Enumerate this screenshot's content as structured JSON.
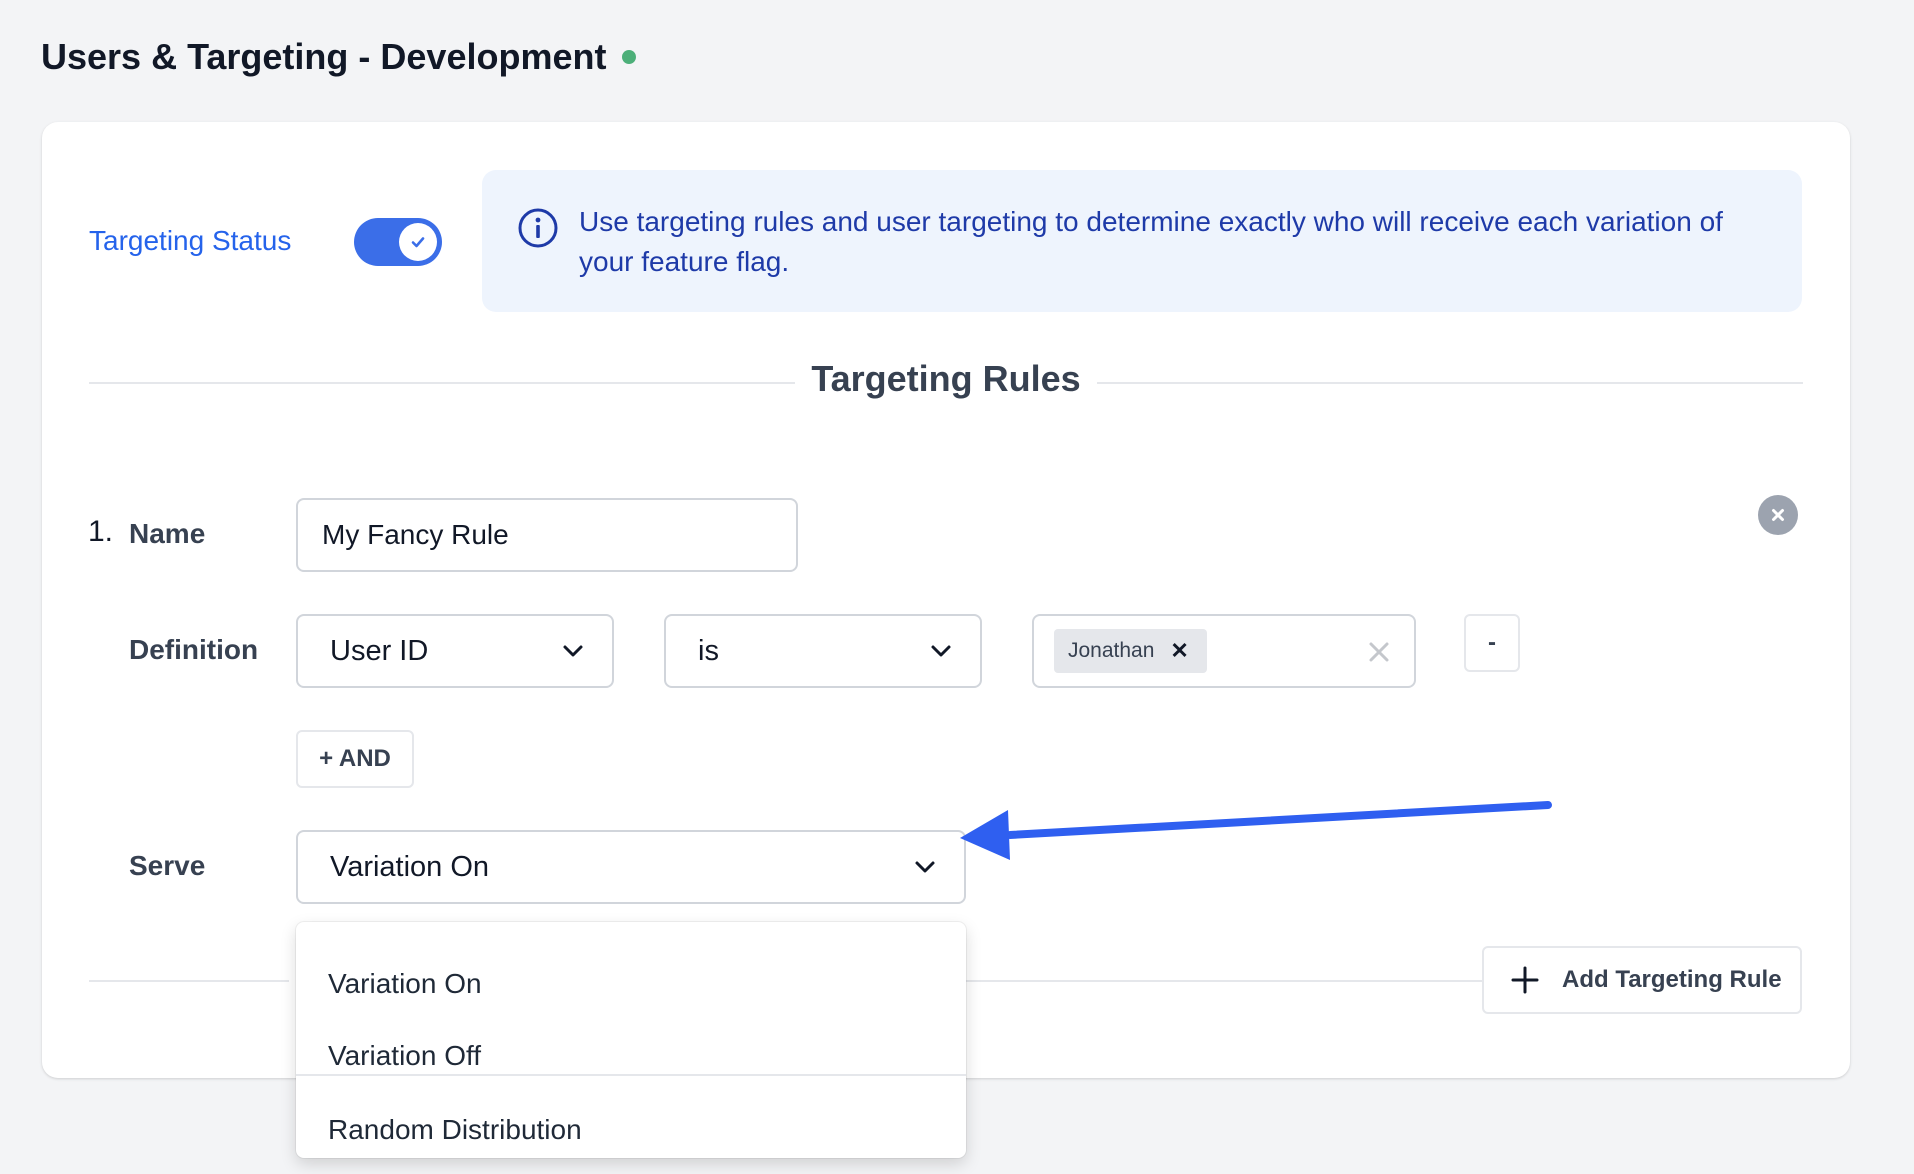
{
  "header": {
    "title": "Users & Targeting - Development",
    "status_color": "#4caf79"
  },
  "targeting": {
    "status_label": "Targeting Status",
    "status_on": true,
    "info_text": "Use targeting rules and user targeting to determine exactly who will receive each variation of your feature flag.",
    "section_title": "Targeting Rules"
  },
  "rule": {
    "number": "1.",
    "name_label": "Name",
    "name_value": "My Fancy Rule",
    "definition_label": "Definition",
    "attribute_value": "User ID",
    "operator_value": "is",
    "values": [
      "Jonathan"
    ],
    "remove_condition_label": "-",
    "and_label": "+ AND",
    "serve_label": "Serve",
    "serve_value": "Variation On",
    "serve_options": [
      "Variation On",
      "Variation Off",
      "Random Distribution"
    ]
  },
  "actions": {
    "add_rule_label": "Add Targeting Rule"
  },
  "colors": {
    "accent": "#3b6ee8",
    "link": "#2563eb",
    "info_bg": "#eef4fd",
    "info_text": "#1e3aa8",
    "annotation_arrow": "#2f5ff0"
  }
}
